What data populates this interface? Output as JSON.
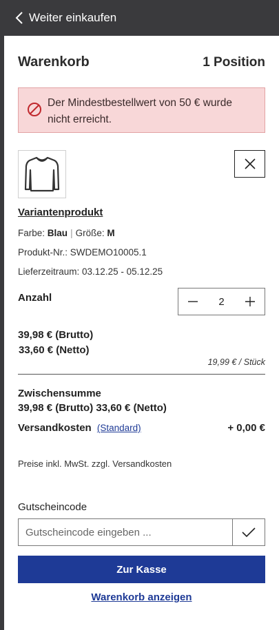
{
  "topbar": {
    "back_label": "Weiter einkaufen"
  },
  "cart": {
    "title": "Warenkorb",
    "positions": "1 Position",
    "alert": "Der Mindestbestellwert von 50 € wurde nicht erreicht."
  },
  "item": {
    "name": "Variantenprodukt",
    "color_label": "Farbe:",
    "color_value": "Blau",
    "size_label": "Größe:",
    "size_value": "M",
    "product_no": "Produkt-Nr.: SWDEMO10005.1",
    "delivery": "Lieferzeitraum: 03.12.25 - 05.12.25",
    "qty_label": "Anzahl",
    "qty_value": "2",
    "price_brutto": "39,98 € (Brutto)",
    "price_netto": "33,60 € (Netto)",
    "unit_price": "19,99 € / Stück"
  },
  "summary": {
    "subtotal_label": "Zwischensumme",
    "subtotal_value": "39,98 € (Brutto) 33,60 € (Netto)",
    "shipping_label": "Versandkosten",
    "shipping_method": "(Standard)",
    "shipping_value": "+ 0,00 €",
    "tax_note": "Preise inkl. MwSt. zzgl. Versandkosten"
  },
  "coupon": {
    "label": "Gutscheincode",
    "placeholder": "Gutscheincode eingeben ..."
  },
  "actions": {
    "checkout": "Zur Kasse",
    "view_cart": "Warenkorb anzeigen"
  },
  "colors": {
    "primary": "#1e3a96",
    "alert_bg": "#f8d7d8",
    "alert_border": "#e2a2a4",
    "topbar": "#3a3a3d"
  },
  "icons": {
    "back": "chevron-left-icon",
    "alert": "forbidden-icon",
    "remove": "close-icon",
    "minus": "minus-icon",
    "plus": "plus-icon",
    "submit": "check-icon",
    "product": "shirt-icon"
  }
}
